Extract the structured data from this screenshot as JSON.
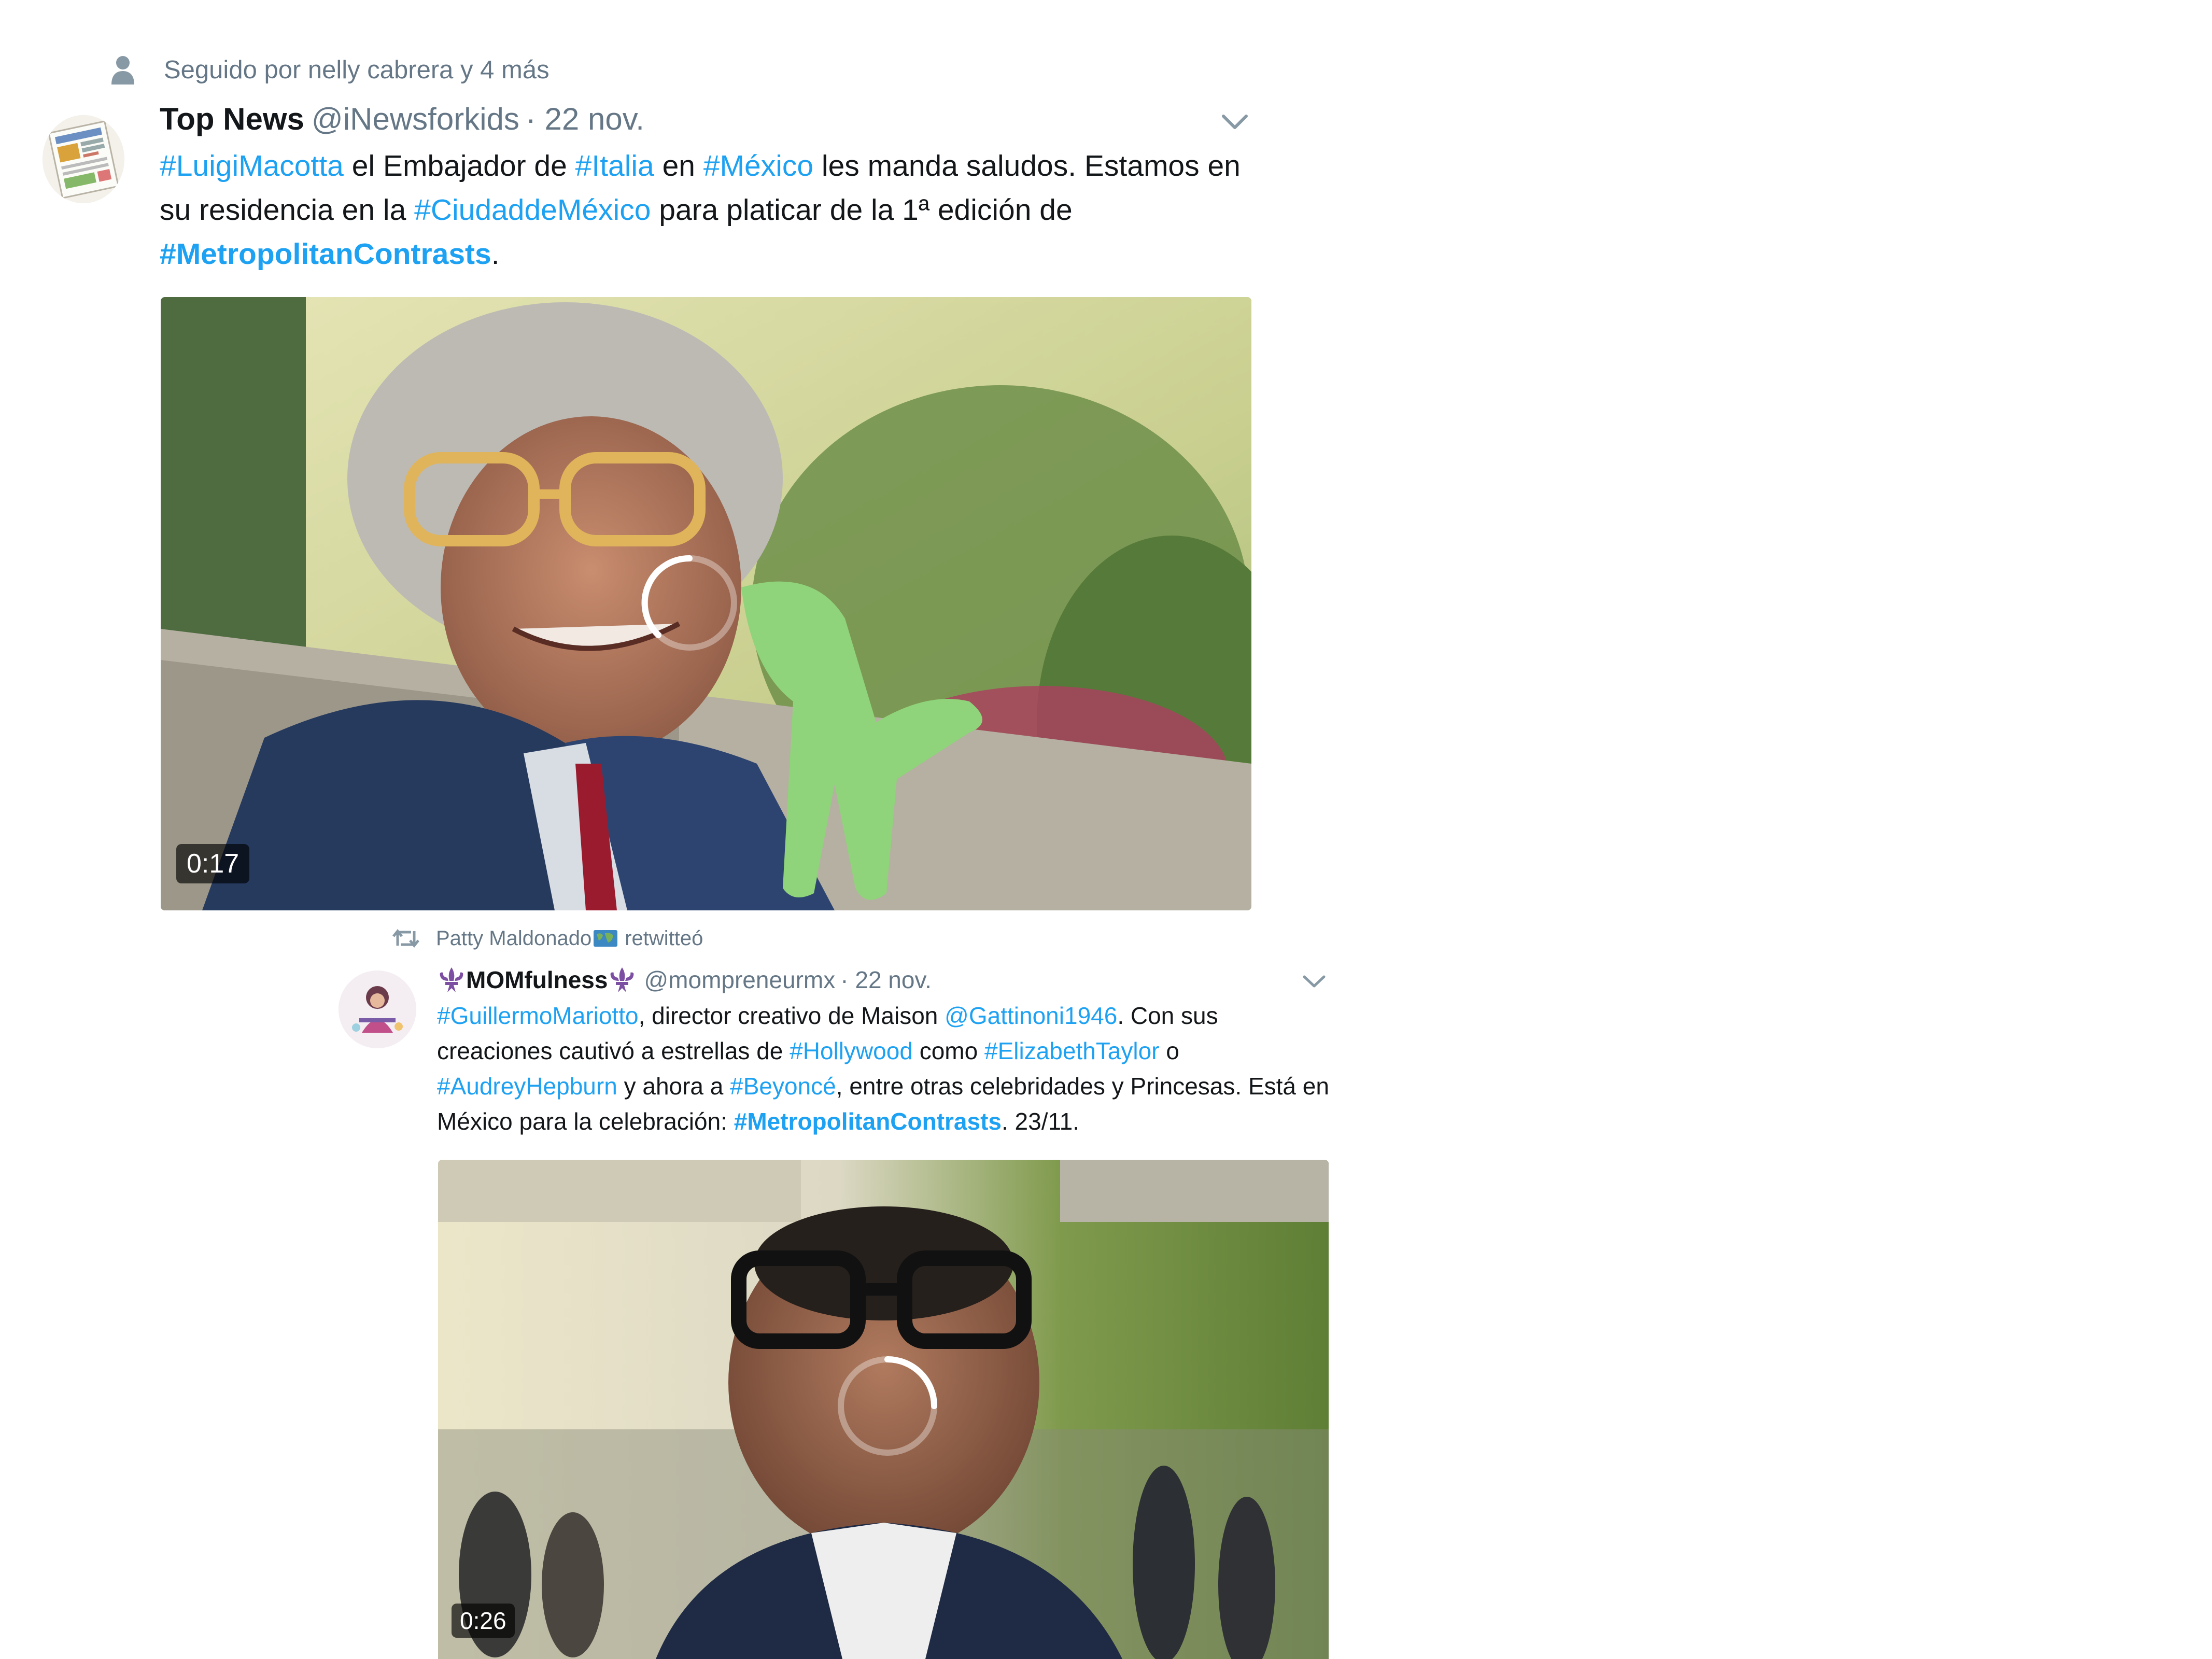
{
  "tweet1": {
    "social_context": "Seguido por nelly cabrera y 4 más",
    "author_name": "Top News",
    "author_handle": "@iNewsforkids",
    "timestamp": "· 22 nov.",
    "text": {
      "h_luigi": "#LuigiMacotta",
      "t1": " el Embajador de ",
      "h_italia": "#Italia",
      "t2": " en ",
      "h_mexico": "#México",
      "t3": " les manda saludos. Estamos en su residencia en la ",
      "h_cdmx": "#CiudaddeMéxico",
      "t4": " para platicar de la 1ª edición de ",
      "h_metro": "#MetropolitanContrasts",
      "t5": "."
    },
    "video_duration": "0:17"
  },
  "tweet2": {
    "retweeter": "Patty Maldonado",
    "retweet_label": "retwitteó",
    "author_name": "MOMfulness",
    "author_handle": "@mompreneurmx",
    "timestamp": "· 22 nov.",
    "text": {
      "h_guillermo": "#GuillermoMariotto",
      "t1": ", director creativo de Maison ",
      "m_gattinoni": "@Gattinoni1946",
      "t2": ". Con sus creaciones cautivó a estrellas de ",
      "h_hollywood": "#Hollywood",
      "t3": " como ",
      "h_elizabeth": "#ElizabethTaylor",
      "t4": " o ",
      "h_audrey": "#AudreyHepburn",
      "t5": " y ahora a ",
      "h_beyonce": "#Beyoncé",
      "t6": ", entre otras celebridades y Princesas. Está en México para la celebración: ",
      "h_metro": "#MetropolitanContrasts",
      "t7": ". 23/11."
    },
    "video_duration": "0:26"
  },
  "colors": {
    "link": "#1da1f2",
    "muted": "#657786",
    "text": "#14171a",
    "fleur": "#7d4fa3"
  },
  "icons": [
    "person-icon",
    "chevron-down-icon",
    "retweet-icon",
    "fleur-de-lis-icon",
    "world-map-emoji",
    "loading-spinner-icon"
  ]
}
